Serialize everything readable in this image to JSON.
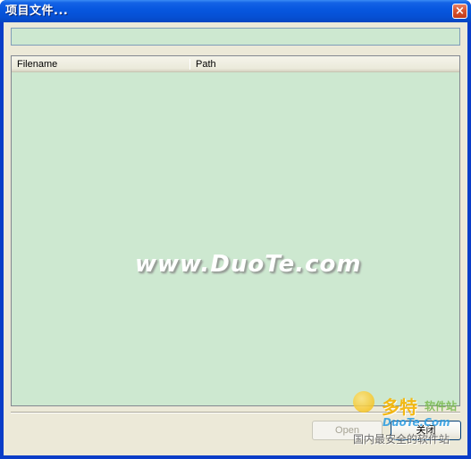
{
  "window": {
    "title": "项目文件...",
    "close_icon": "close-icon",
    "close_glyph": "×"
  },
  "path_field": {
    "value": ""
  },
  "file_list": {
    "columns": [
      "Filename",
      "Path"
    ],
    "rows": []
  },
  "buttons": {
    "open_label": "Open",
    "close_label": "关闭"
  },
  "watermarks": {
    "center": "www.DuoTe.com",
    "brand_title": "多特",
    "brand_sub": "软件站",
    "brand_url": "DuoTe.Com",
    "brand_slogan": "国内最安全的软件站"
  },
  "colors": {
    "title_bar": "#0757e0",
    "list_background": "#cde8d0",
    "dialog_background": "#ece9d8"
  }
}
